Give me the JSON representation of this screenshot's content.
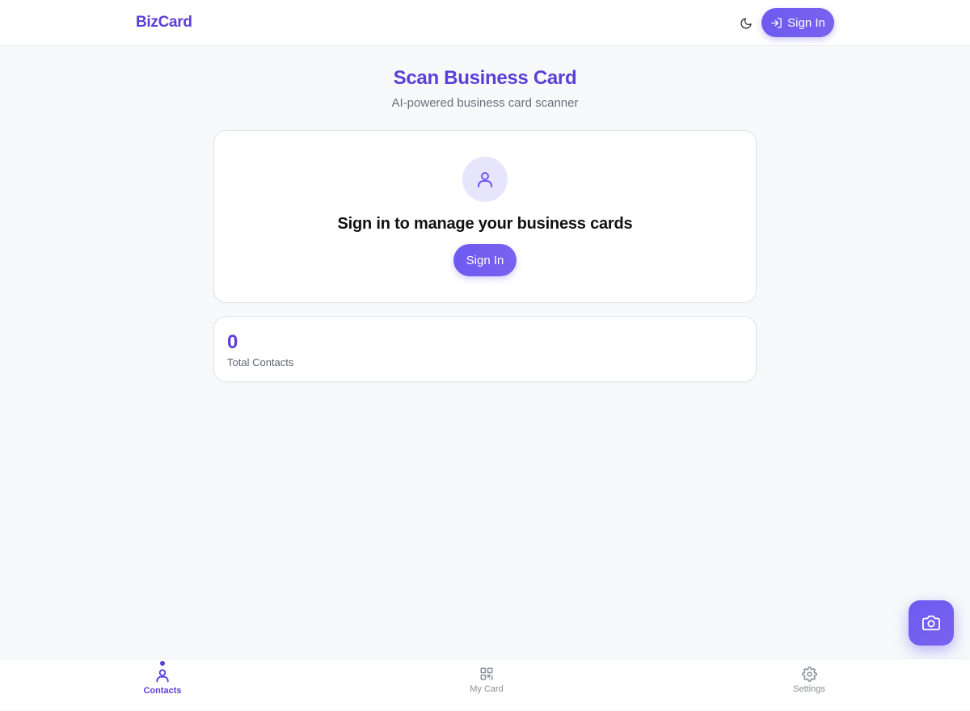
{
  "header": {
    "brand": "BizCard",
    "theme_icon": "moon-icon",
    "signin_label": "Sign In",
    "signin_icon": "sign-in-arrow-icon"
  },
  "hero": {
    "title": "Scan Business Card",
    "subtitle": "AI-powered business card scanner"
  },
  "signin_card": {
    "icon": "user-icon",
    "heading": "Sign in to manage your business cards",
    "button_label": "Sign In"
  },
  "stats": {
    "total_contacts_value": "0",
    "total_contacts_label": "Total Contacts"
  },
  "fab": {
    "icon": "camera-icon"
  },
  "bottom_nav": {
    "items": [
      {
        "label": "Contacts",
        "icon": "user-icon",
        "active": true
      },
      {
        "label": "My Card",
        "icon": "qr-code-icon",
        "active": false
      },
      {
        "label": "Settings",
        "icon": "gear-icon",
        "active": false
      }
    ]
  },
  "colors": {
    "accent": "#5b3fd6",
    "button": "#6d5af0",
    "background": "#f8f9fb",
    "muted_text": "#6b6f7b"
  }
}
